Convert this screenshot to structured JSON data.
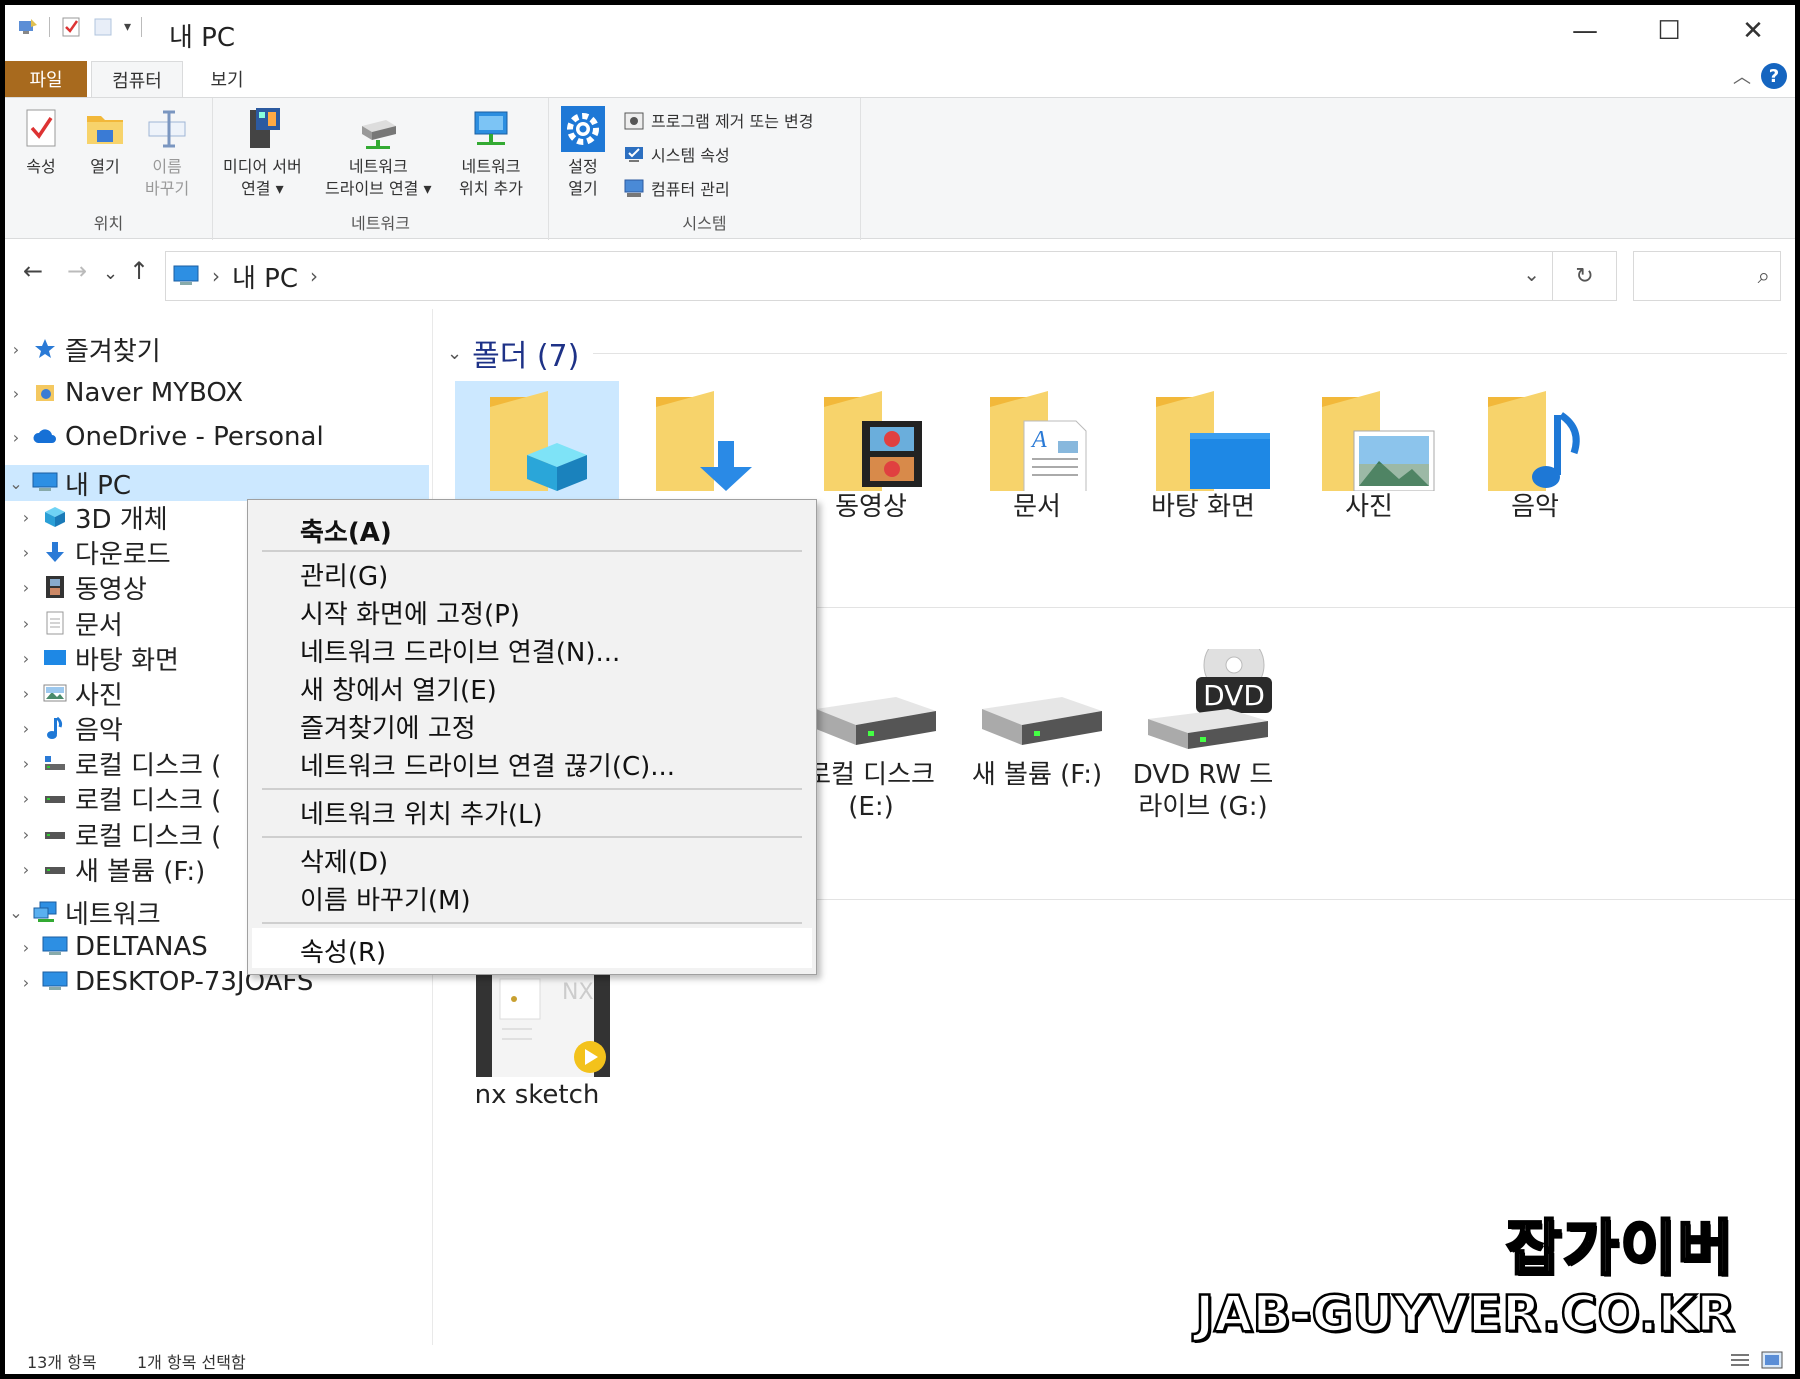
{
  "window": {
    "title": "내 PC",
    "minimize": "—",
    "maximize": "☐",
    "close": "✕"
  },
  "ribbon": {
    "tabs": [
      "파일",
      "컴퓨터",
      "보기"
    ],
    "help": "?",
    "collapse": "︿",
    "groups": {
      "location": {
        "label": "위치",
        "properties": "속성",
        "open": "열기",
        "rename_1": "이름",
        "rename_2": "바꾸기"
      },
      "network": {
        "label": "네트워크",
        "media_1": "미디어 서버",
        "media_2": "연결 ▾",
        "netdrive_1": "네트워크",
        "netdrive_2": "드라이브 연결 ▾",
        "netloc_1": "네트워크",
        "netloc_2": "위치 추가"
      },
      "system": {
        "label": "시스템",
        "settings_1": "설정",
        "settings_2": "열기",
        "uninstall": "프로그램 제거 또는 변경",
        "sysprops": "시스템 속성",
        "manage": "컴퓨터 관리"
      }
    }
  },
  "nav": {
    "back": "←",
    "forward": "→",
    "recent": "⌄",
    "up": "↑",
    "crumb_sep": "›",
    "crumb": "내 PC",
    "dropdown": "⌄",
    "refresh": "↻",
    "search_icon": "⌕"
  },
  "tree": {
    "expand": "›",
    "collapse": "⌄",
    "items": [
      {
        "label": "즐겨찾기"
      },
      {
        "label": "Naver MYBOX"
      },
      {
        "label": "OneDrive - Personal"
      },
      {
        "label": "내 PC"
      },
      {
        "label": "3D 개체"
      },
      {
        "label": "다운로드"
      },
      {
        "label": "동영상"
      },
      {
        "label": "문서"
      },
      {
        "label": "바탕 화면"
      },
      {
        "label": "사진"
      },
      {
        "label": "음악"
      },
      {
        "label": "로컬 디스크 ("
      },
      {
        "label": "로컬 디스크 ("
      },
      {
        "label": "로컬 디스크 ("
      },
      {
        "label": "새 볼륨 (F:)"
      },
      {
        "label": "네트워크"
      },
      {
        "label": "DELTANAS"
      },
      {
        "label": "DESKTOP-73JOAFS"
      }
    ]
  },
  "content": {
    "folders_header": "폴더 (7)",
    "group_chevron": "⌄",
    "folders": [
      "3D 개체",
      "다운로드",
      "동영상",
      "문서",
      "바탕 화면",
      "사진",
      "음악"
    ],
    "drives": [
      {
        "line1": "로컬 디스크",
        "line2": "(E:)"
      },
      {
        "line1": "새 볼륨 (F:)",
        "line2": ""
      },
      {
        "line1": "DVD RW 드",
        "line2": "라이브 (G:)"
      }
    ],
    "dvd_badge": "DVD",
    "network_item": "nx sketch"
  },
  "context_menu": {
    "items": [
      "축소(A)",
      "관리(G)",
      "시작 화면에 고정(P)",
      "네트워크 드라이브 연결(N)...",
      "새 창에서 열기(E)",
      "즐겨찾기에 고정",
      "네트워크 드라이브 연결 끊기(C)...",
      "네트워크 위치 추가(L)",
      "삭제(D)",
      "이름 바꾸기(M)",
      "속성(R)"
    ]
  },
  "status": {
    "count": "13개 항목",
    "selected": "1개 항목 선택함"
  },
  "watermark": {
    "korean": "잡가이버",
    "english": "JAB-GUYVER.CO.KR"
  },
  "colors": {
    "file_tab": "#a86a1e",
    "selection": "#cce8ff",
    "group_title": "#1e3287",
    "folder": "#f7d36b",
    "accent_blue": "#1e88e5"
  }
}
